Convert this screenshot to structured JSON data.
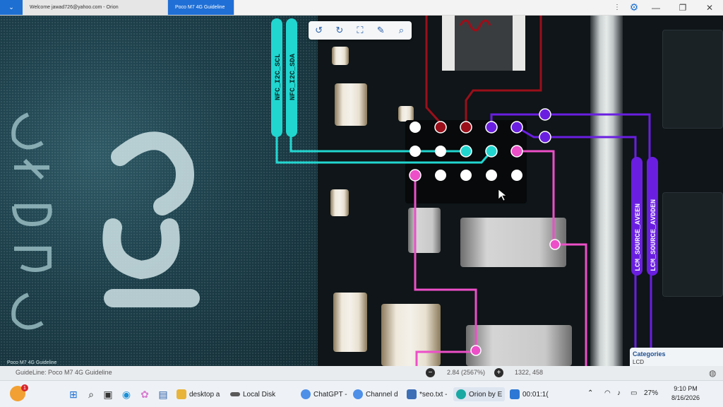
{
  "window": {
    "tabs": [
      {
        "label": "Welcome jawad726@yahoo.com - Orion"
      },
      {
        "label": "Poco M7 4G Guideline"
      }
    ],
    "controls": {
      "settings": "⚙",
      "minimize": "—",
      "restore": "❐",
      "close": "✕"
    }
  },
  "toolbar": {
    "tools": [
      "rotate-left",
      "rotate-right",
      "fit-screen",
      "brush",
      "search"
    ]
  },
  "chip": {
    "caption": "Poco M7 4G Guideline"
  },
  "nets": {
    "labels": [
      "NFC_I2C_SCL",
      "NFC_I2C_SDA",
      "LCM_SOURCE_AVEEN",
      "LCM_SOURCE_AVDDEN"
    ],
    "colors": {
      "cyan": "#22d6d0",
      "purple": "#6a1fe0",
      "pink": "#ec4fc8",
      "red": "#9a0f1a"
    }
  },
  "categories": {
    "title": "Categories",
    "item": "LCD"
  },
  "status": {
    "guideline": "GuideLine: Poco M7 4G Guideline",
    "zoom": "2.84 (2567%)",
    "coords": "1322, 458"
  },
  "taskbar": {
    "weather_badge": "1",
    "apps": [
      {
        "label": "desktop a",
        "color": "#e8b43a"
      },
      {
        "label": "Local Disk",
        "color": "#5a5a5a"
      },
      {
        "label": "ChatGPT -",
        "color": "#4e8fe8"
      },
      {
        "label": "Channel d",
        "color": "#4e8fe8"
      },
      {
        "label": "*seo.txt -",
        "color": "#3d6fb7"
      },
      {
        "label": "Orion by E",
        "color": "#1aa9a3"
      },
      {
        "label": "00:01:1(",
        "color": "#2c78d4"
      }
    ],
    "battery": "27%",
    "time": "9:10 PM",
    "date": "8/16/2026"
  }
}
